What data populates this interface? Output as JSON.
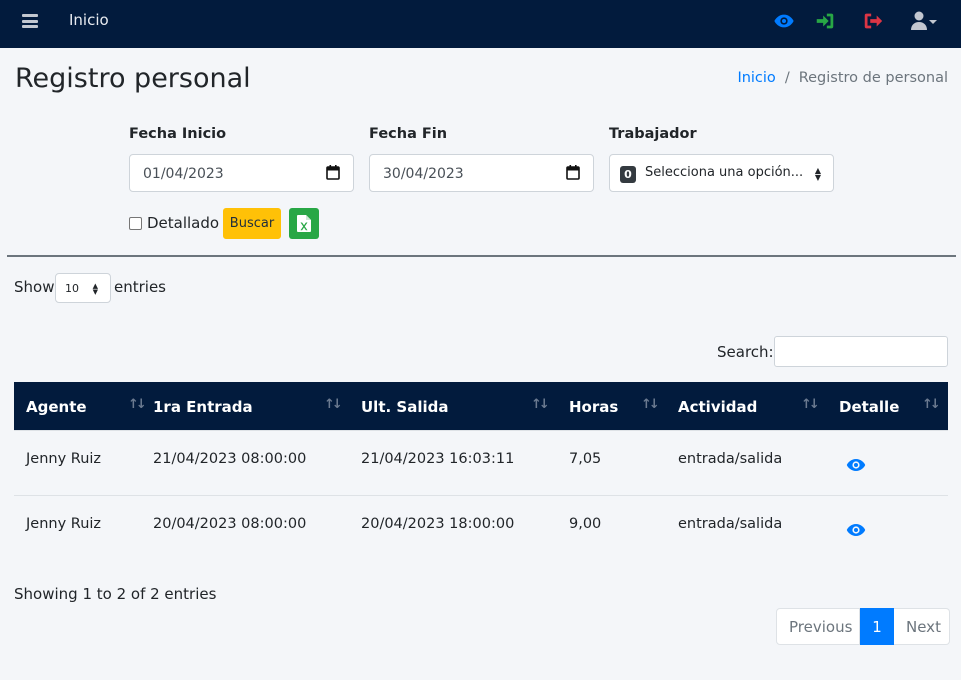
{
  "navbar": {
    "title": "Inicio",
    "icons": [
      "eye-icon",
      "sign-in-icon",
      "sign-out-icon",
      "user-icon"
    ],
    "colors": {
      "background": "#021b3d",
      "eye": "#007bff",
      "sign_in": "#28a745",
      "sign_out": "#dc3545",
      "user": "#c2c7d0"
    }
  },
  "page": {
    "title": "Registro personal",
    "breadcrumb": {
      "home": "Inicio",
      "separator": "/",
      "current": "Registro de personal"
    }
  },
  "filters": {
    "start_label": "Fecha Inicio",
    "start_value": "01/04/2023",
    "end_label": "Fecha Fin",
    "end_value": "30/04/2023",
    "worker_label": "Trabajador",
    "worker_count": "0",
    "worker_placeholder": "Selecciona una opción...",
    "detail_label": "Detallado",
    "detail_checked": false,
    "search_button": "Buscar",
    "excel_icon": "file-excel-icon"
  },
  "datatable": {
    "show_label": "Show",
    "length_value": "10",
    "entries_label": "entries",
    "search_label": "Search:",
    "search_value": "",
    "columns": [
      "Agente",
      "1ra Entrada",
      "Ult. Salida",
      "Horas",
      "Actividad",
      "Detalle"
    ],
    "rows": [
      {
        "agente": "Jenny Ruiz",
        "entrada": "21/04/2023 08:00:00",
        "salida": "21/04/2023 16:03:11",
        "horas": "7,05",
        "actividad": "entrada/salida",
        "detalle": "eye-icon"
      },
      {
        "agente": "Jenny Ruiz",
        "entrada": "20/04/2023 08:00:00",
        "salida": "20/04/2023 18:00:00",
        "horas": "9,00",
        "actividad": "entrada/salida",
        "detalle": "eye-icon"
      }
    ],
    "info": "Showing 1 to 2 of 2 entries",
    "pagination": {
      "previous": "Previous",
      "current": "1",
      "next": "Next"
    }
  }
}
